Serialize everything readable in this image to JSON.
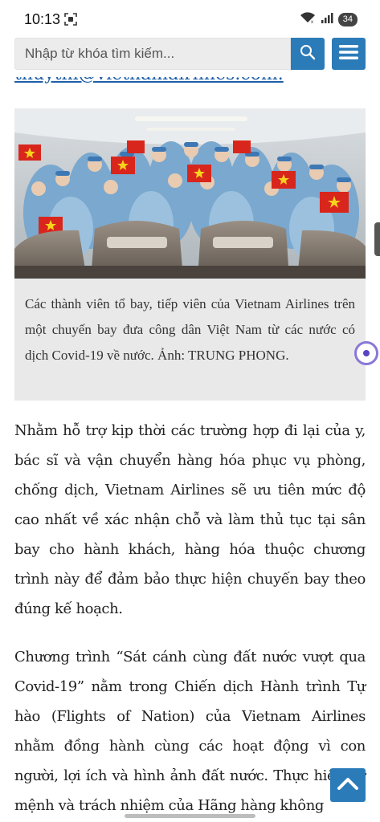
{
  "status_bar": {
    "time": "10:13",
    "battery": "34"
  },
  "search": {
    "placeholder": "Nhập từ khóa tìm kiếm..."
  },
  "article": {
    "email_link": "thuythi@vietnamairlines.com.",
    "image": {
      "caption": "Các thành viên tổ bay, tiếp viên của Vietnam Airlines trên một chuyến bay đưa công dân Việt Nam từ các nước có dịch Covid-19 về nước. Ảnh: TRUNG PHONG."
    },
    "paragraphs": [
      "Nhằm hỗ trợ kịp thời các trường hợp đi lại của y, bác sĩ và vận chuyển hàng hóa phục vụ phòng, chống dịch, Vietnam Airlines sẽ ưu tiên mức độ cao nhất về xác nhận chỗ và làm thủ tục tại sân bay cho hành khách, hàng hóa thuộc chương trình này để đảm bảo thực hiện chuyến bay theo đúng kế hoạch.",
      "Chương trình “Sát cánh cùng đất nước vượt qua Covid-19” nằm trong Chiến dịch Hành trình Tự hào (Flights of Nation) của Vietnam Airlines nhằm đồng hành cùng các hoạt động vì con người, lợi ích và hình ảnh đất nước. Thực hiện sứ mệnh và trách nhiệm của Hãng hàng không"
    ]
  },
  "colors": {
    "accent": "#2b7bb9",
    "link": "#1e5fa8",
    "caption_bg": "#e9e9e9"
  },
  "icons": [
    "screen-record-icon",
    "wifi-icon",
    "signal-icon",
    "battery-icon",
    "search-icon",
    "hamburger-menu-icon",
    "chevron-up-icon",
    "assistant-bubble-icon"
  ]
}
